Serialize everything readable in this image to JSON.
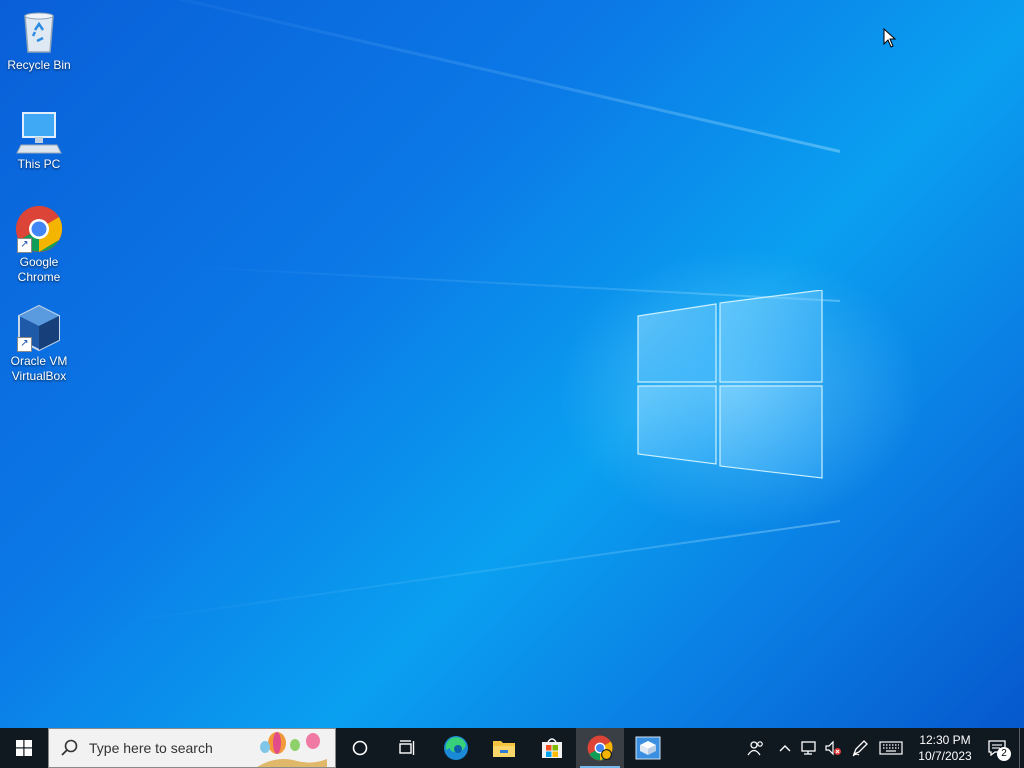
{
  "desktop": {
    "icons": [
      {
        "label_line1": "Recycle Bin",
        "label_line2": "",
        "icon": "recycle-bin-icon"
      },
      {
        "label_line1": "This PC",
        "label_line2": "",
        "icon": "this-pc-icon"
      },
      {
        "label_line1": "Google",
        "label_line2": "Chrome",
        "icon": "chrome-icon"
      },
      {
        "label_line1": "Oracle VM",
        "label_line2": "VirtualBox",
        "icon": "virtualbox-icon"
      }
    ]
  },
  "taskbar": {
    "search_placeholder": "Type here to search",
    "apps": [
      "cortana-icon",
      "task-view-icon",
      "edge-icon",
      "file-explorer-icon",
      "microsoft-store-icon",
      "chrome-icon",
      "virtualbox-manager-icon"
    ],
    "clock": {
      "time": "12:30 PM",
      "date": "10/7/2023"
    },
    "notification_count": "2"
  },
  "colors": {
    "taskbar_bg": "#101820",
    "desktop_accent": "#0a78e6",
    "running_indicator": "#76b9ed"
  }
}
